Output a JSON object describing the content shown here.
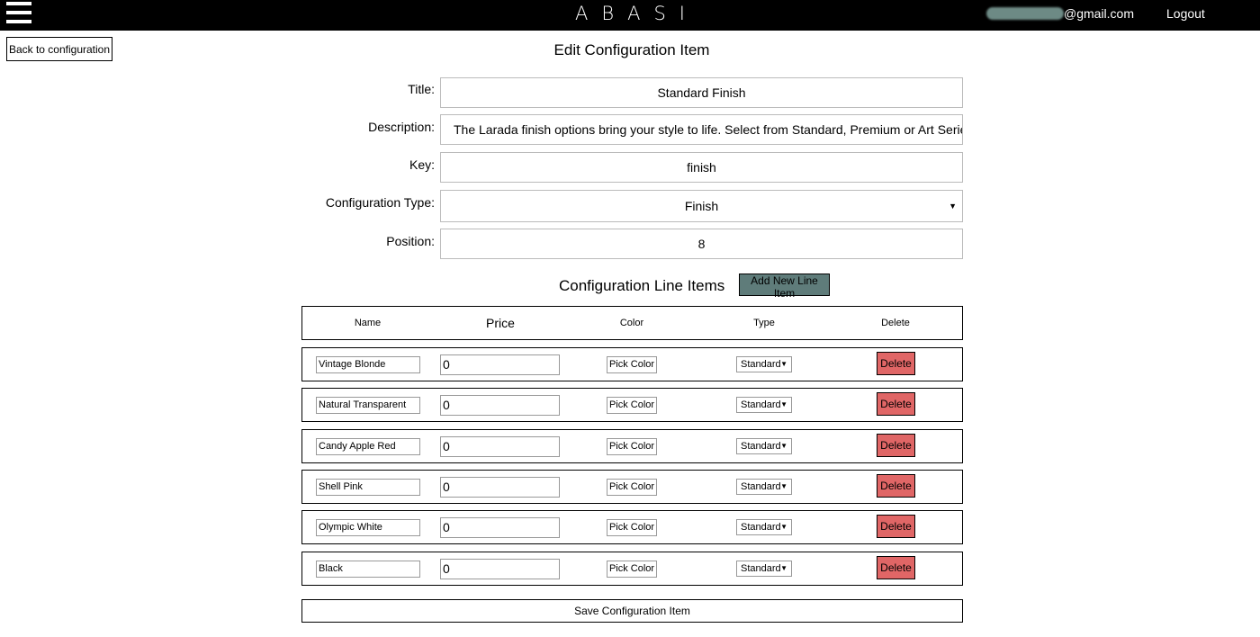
{
  "header": {
    "brand": "ABASI",
    "email": "@gmail.com",
    "logout": "Logout"
  },
  "back_label": "Back to configuration",
  "page_title": "Edit Configuration Item",
  "form": {
    "title_label": "Title:",
    "title_value": "Standard Finish",
    "description_label": "Description:",
    "description_value": "The Larada finish options bring your style to life. Select from Standard, Premium or Art Series op",
    "key_label": "Key:",
    "key_value": "finish",
    "config_type_label": "Configuration Type:",
    "config_type_value": "Finish",
    "position_label": "Position:",
    "position_value": "8"
  },
  "line_items": {
    "title": "Configuration Line Items",
    "add_label": "Add New Line Item",
    "columns": [
      "Name",
      "Price",
      "Color",
      "Type",
      "Delete"
    ],
    "rows": [
      {
        "name": "Vintage Blonde",
        "price": "0",
        "color_btn": "Pick Color",
        "type": "Standard",
        "delete": "Delete"
      },
      {
        "name": "Natural Transparent",
        "price": "0",
        "color_btn": "Pick Color",
        "type": "Standard",
        "delete": "Delete"
      },
      {
        "name": "Candy Apple Red",
        "price": "0",
        "color_btn": "Pick Color",
        "type": "Standard",
        "delete": "Delete"
      },
      {
        "name": "Shell Pink",
        "price": "0",
        "color_btn": "Pick Color",
        "type": "Standard",
        "delete": "Delete"
      },
      {
        "name": "Olympic White",
        "price": "0",
        "color_btn": "Pick Color",
        "type": "Standard",
        "delete": "Delete"
      },
      {
        "name": "Black",
        "price": "0",
        "color_btn": "Pick Color",
        "type": "Standard",
        "delete": "Delete"
      }
    ]
  },
  "save_label": "Save Configuration Item",
  "colors": {
    "topbar": "#000000",
    "add_button": "#5f7c7a",
    "delete_button": "#e06666"
  }
}
